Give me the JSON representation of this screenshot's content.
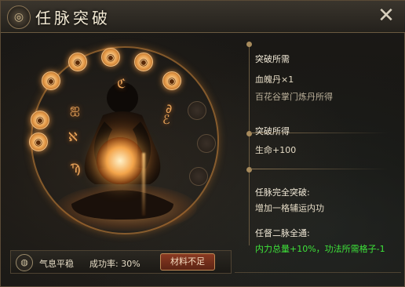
{
  "window": {
    "title": "任脉突破",
    "emblem_glyph": "◎",
    "close_glyph": "✕"
  },
  "ritual": {
    "nodes": [
      {
        "glyph": "◉",
        "active": true
      },
      {
        "glyph": "◉",
        "active": true
      },
      {
        "glyph": "◉",
        "active": true
      },
      {
        "glyph": "◉",
        "active": true
      },
      {
        "glyph": "◉",
        "active": true
      },
      {
        "glyph": "◉",
        "active": true
      },
      {
        "glyph": "◉",
        "active": true
      },
      {
        "glyph": "",
        "active": false
      },
      {
        "glyph": "",
        "active": false
      },
      {
        "glyph": "",
        "active": false
      }
    ],
    "runes": [
      "ℭ",
      "ஐ",
      "∂",
      "ℰ",
      "ℵ",
      "Ϡ"
    ]
  },
  "info": {
    "require_heading": "突破所需",
    "require_item": "血魄丹×1",
    "require_source": "百花谷掌门炼丹所得",
    "gain_heading": "突破所得",
    "gain_value": "生命+100",
    "full_heading": "任脉完全突破:",
    "full_value": "增加一格辅运内功",
    "dual_heading": "任督二脉全通:",
    "dual_value": "内力总量+10%，功法所需格子-1"
  },
  "bottom": {
    "icon": "qi-icon",
    "icon_glyph": "◍",
    "status": "气息平稳",
    "rate": "成功率: 30%",
    "button": "材料不足"
  },
  "colors": {
    "accent": "#e59a48",
    "green_text": "#3ee43a",
    "button_red": "#8a3a22"
  }
}
